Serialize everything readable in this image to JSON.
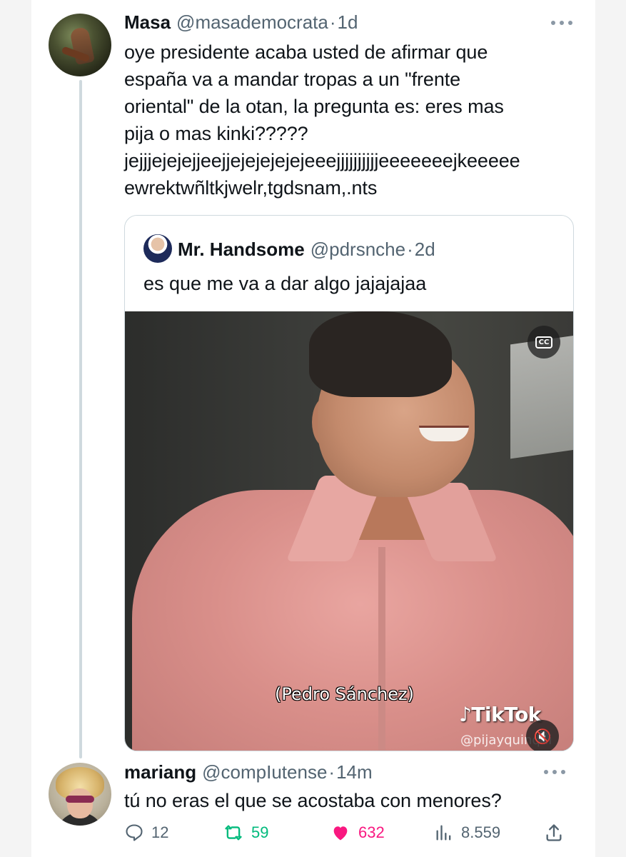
{
  "tweet": {
    "name": "Masa",
    "handle": "@masademocrata",
    "separator": "·",
    "time": "1d",
    "text_lines": [
      "oye presidente acaba usted de afirmar que",
      "españa va a mandar tropas a un \"frente",
      "oriental\" de la otan, la pregunta es: eres mas",
      "pija o mas kinki?????",
      "jejjjejejejjeejjejejejejejeeejjjjjjjjjjeeeeeeejkeeeee",
      "ewrektwñltkjwelr,tgdsnam,.nts"
    ]
  },
  "quote": {
    "name": "Mr. Handsome",
    "handle": "@pdrsnche",
    "separator": "·",
    "time": "2d",
    "text": "es que me va a dar algo jajajajaa",
    "media": {
      "caption": "(Pedro Sánchez)",
      "watermark": "TikTok",
      "watermark_handle": "@pijayquinqui",
      "cc_label": "CC",
      "mute_icon": "speaker-muted-icon"
    }
  },
  "reply": {
    "name": "mariang",
    "handle": "@compIutense",
    "separator": "·",
    "time": "14m",
    "text": "tú no eras el que se acostaba con menores?",
    "stats": {
      "replies": "12",
      "retweets": "59",
      "likes": "632",
      "views": "8.559"
    }
  },
  "colors": {
    "retweet": "#00ba7c",
    "like": "#f91880",
    "secondary": "#536471"
  }
}
